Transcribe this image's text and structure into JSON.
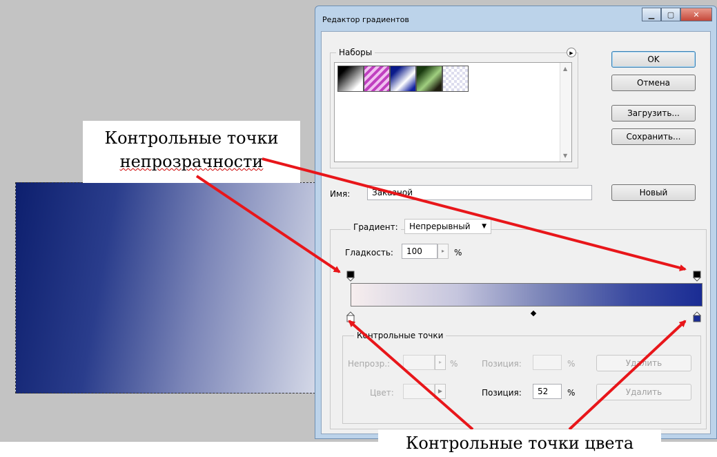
{
  "dialog": {
    "title": "Редактор градиентов",
    "presets_label": "Наборы",
    "buttons": {
      "ok": "OK",
      "cancel": "Отмена",
      "load": "Загрузить...",
      "save": "Сохранить...",
      "new": "Новый"
    },
    "name_label": "Имя:",
    "name_value": "Заказной",
    "gradient_type_label": "Градиент:",
    "gradient_type_value": "Непрерывный",
    "smoothness_label": "Гладкость:",
    "smoothness_value": "100",
    "smoothness_unit": "%",
    "stops_group_label": "Контрольные точки",
    "opacity_label": "Непрозр.:",
    "opacity_unit": "%",
    "opacity_position_label": "Позиция:",
    "opacity_position_unit": "%",
    "opacity_delete": "Удалить",
    "color_label": "Цвет:",
    "color_position_label": "Позиция:",
    "color_position_value": "52",
    "color_position_unit": "%",
    "color_delete": "Удалить",
    "midpoint_position": 0.52
  },
  "annotations": {
    "opacity_stops_line1": "Контрольные точки",
    "opacity_stops_line2": "непрозрачности",
    "color_stops": "Контрольные точки цвета"
  },
  "colors": {
    "annotation_arrow": "#e8161a",
    "gradient_start": "#f7eeee",
    "gradient_end": "#1a2c94"
  }
}
